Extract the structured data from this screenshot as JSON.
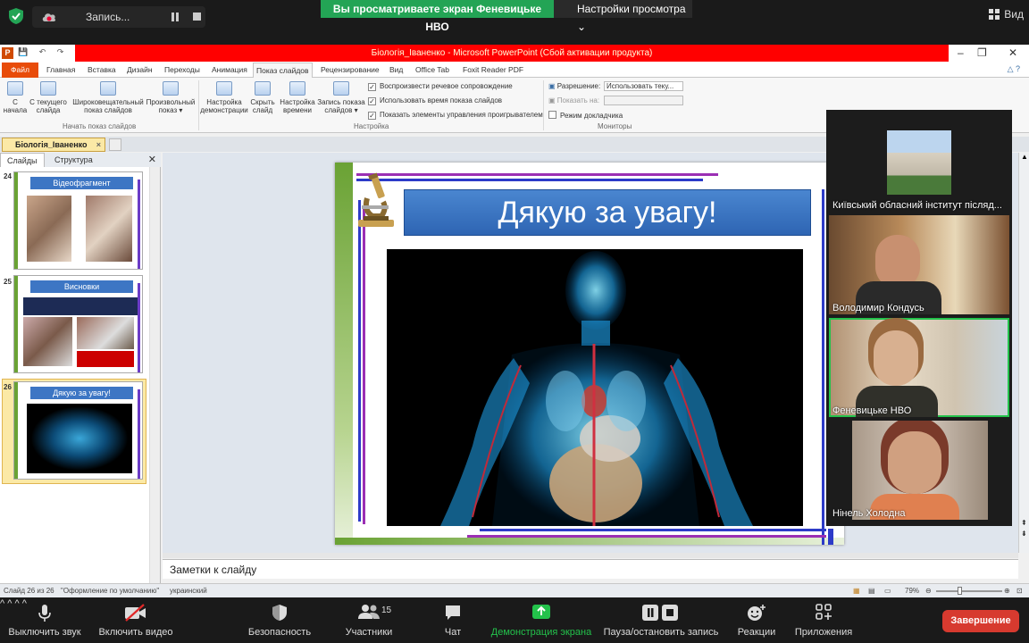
{
  "zoom_top": {
    "recording_label": "Запись...",
    "viewing_banner": "Вы просматриваете экран Феневицьке НВО",
    "view_options": "Настройки просмотра",
    "view_button": "Вид"
  },
  "ppt": {
    "window_title": "Біологія_Іваненко  -  Microsoft PowerPoint (Сбой активации продукта)",
    "logo": "P",
    "tabs": [
      "Файл",
      "Главная",
      "Вставка",
      "Дизайн",
      "Переходы",
      "Анимация",
      "Показ слайдов",
      "Рецензирование",
      "Вид",
      "Office Tab",
      "Foxit Reader PDF"
    ],
    "active_tab": "Показ слайдов",
    "ribbon": {
      "buttons": [
        {
          "l1": "С",
          "l2": "начала"
        },
        {
          "l1": "С текущего",
          "l2": "слайда"
        },
        {
          "l1": "Широковещательный",
          "l2": "показ слайдов"
        },
        {
          "l1": "Произвольный",
          "l2": "показ ▾"
        },
        {
          "l1": "Настройка",
          "l2": "демонстрации"
        },
        {
          "l1": "Скрыть",
          "l2": "слайд"
        },
        {
          "l1": "Настройка",
          "l2": "времени"
        },
        {
          "l1": "Запись показа",
          "l2": "слайдов ▾"
        }
      ],
      "group_start": "Начать показ слайдов",
      "group_setup": "Настройка",
      "group_monitors": "Мониторы",
      "checks": [
        "Воспроизвести речевое сопровождение",
        "Использовать время показа слайдов",
        "Показать элементы управления проигрывателем"
      ],
      "resolution_label": "Разрешение:",
      "resolution_value": "Использовать теку...",
      "show_on_label": "Показать на:",
      "presenter_mode": "Режим докладчика"
    },
    "doc_tab": "Біологія_Іваненко",
    "sidebar_tabs": [
      "Слайды",
      "Структура"
    ],
    "thumbs": [
      {
        "num": "24",
        "title": "Відеофрагмент"
      },
      {
        "num": "25",
        "title": "Висновки"
      },
      {
        "num": "26",
        "title": "Дякую за увагу!"
      }
    ],
    "slide_title": "Дякую за увагу!",
    "notes_placeholder": "Заметки к слайду",
    "status": {
      "slide": "Слайд 26 из 26",
      "theme": "\"Оформление по умолчанию\"",
      "lang": "украинский",
      "zoom": "79%"
    }
  },
  "gallery": [
    {
      "name": "Київський обласний інститут післяд..."
    },
    {
      "name": "Володимир Кондусь"
    },
    {
      "name": "Феневицьке НВО"
    },
    {
      "name": "Нінель Холодна"
    }
  ],
  "zoom_bar": {
    "mute": "Выключить звук",
    "video": "Включить видео",
    "security": "Безопасность",
    "participants": "Участники",
    "participants_count": "15",
    "chat": "Чат",
    "share": "Демонстрация экрана",
    "pause_rec": "Пауза/остановить запись",
    "reactions": "Реакции",
    "apps": "Приложения",
    "end": "Завершение"
  }
}
